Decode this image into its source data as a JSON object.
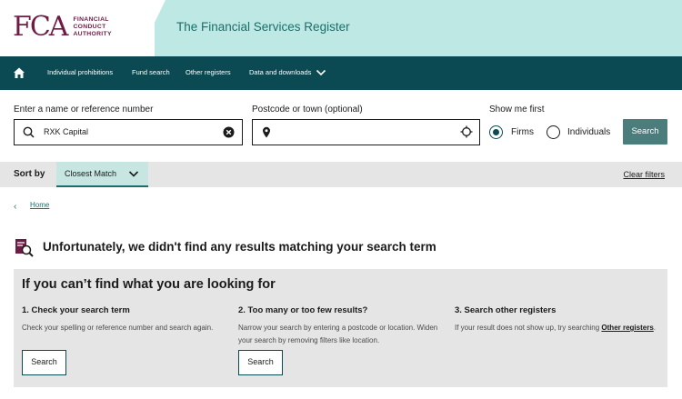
{
  "header": {
    "logo_mark": "FCA",
    "logo_lines": [
      "FINANCIAL",
      "CONDUCT",
      "AUTHORITY"
    ],
    "title": "The Financial Services Register"
  },
  "nav": {
    "home_icon": "home-icon",
    "items": [
      "Individual prohibitions",
      "Fund search",
      "Other registers",
      "Data and downloads"
    ]
  },
  "search": {
    "name_label": "Enter a name or reference number",
    "name_value": "RXK Capital",
    "postcode_label": "Postcode or town (optional)",
    "postcode_value": "",
    "show_label": "Show me first",
    "radio_firms": "Firms",
    "radio_individuals": "Individuals",
    "selected": "Firms",
    "button": "Search"
  },
  "sort": {
    "label": "Sort by",
    "value": "Closest Match",
    "clear": "Clear filters"
  },
  "breadcrumb": {
    "home": "Home"
  },
  "results": {
    "message": "Unfortunately, we didn't find any results matching your search term"
  },
  "help": {
    "title": "If you can’t find what you are looking for",
    "columns": [
      {
        "title": "1. Check your search term",
        "body": "Check your spelling or reference number and search again.",
        "button": "Search"
      },
      {
        "title": "2. Too many or too few results?",
        "body": "Narrow your search by entering a postcode or location. Widen your search by removing filters like location.",
        "button": "Search"
      },
      {
        "title": "3. Search other registers",
        "body_prefix": "If your result does not show up, try searching ",
        "link": "Other registers",
        "body_suffix": "."
      }
    ]
  },
  "colors": {
    "brand": "#701b45",
    "nav_bg": "#0b4a52",
    "header_bg": "#bde8e3",
    "button_bg": "#4a7d7b"
  }
}
